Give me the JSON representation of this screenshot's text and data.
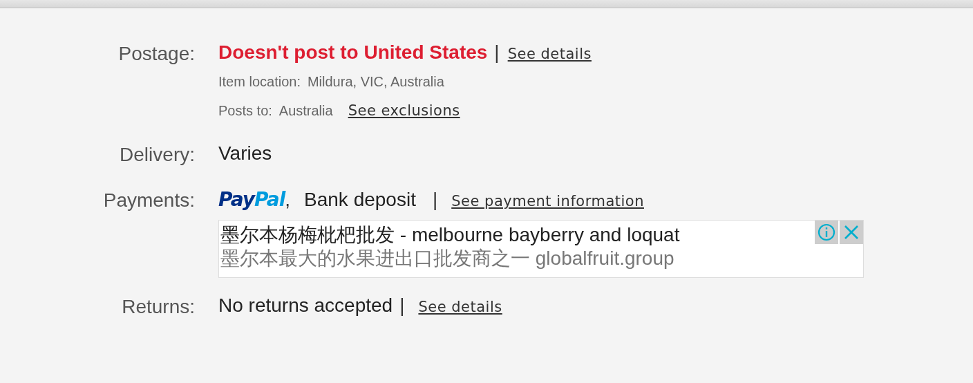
{
  "rows": [
    {
      "kind": "postage",
      "label": "Postage:",
      "status": "Doesn't post to United States",
      "separator": "|",
      "link": "See details",
      "details": [
        {
          "label": "Item location:",
          "value": "Mildura, VIC, Australia"
        },
        {
          "label": "Posts to:",
          "value": "Australia",
          "link": "See exclusions"
        }
      ]
    },
    {
      "kind": "plain",
      "label": "Delivery:",
      "value": "Varies"
    },
    {
      "kind": "payments",
      "label": "Payments:",
      "logo_text": "PayPal",
      "comma": ",",
      "value": "Bank deposit",
      "separator": "|",
      "link": "See payment information",
      "ad": {
        "headline": "墨尔本杨梅枇杷批发 - melbourne bayberry and loquat",
        "description": "墨尔本最大的水果进出口批发商之一 globalfruit.group"
      }
    },
    {
      "kind": "returns",
      "label": "Returns:",
      "value": "No returns accepted",
      "separator": "|",
      "link": "See details"
    }
  ]
}
